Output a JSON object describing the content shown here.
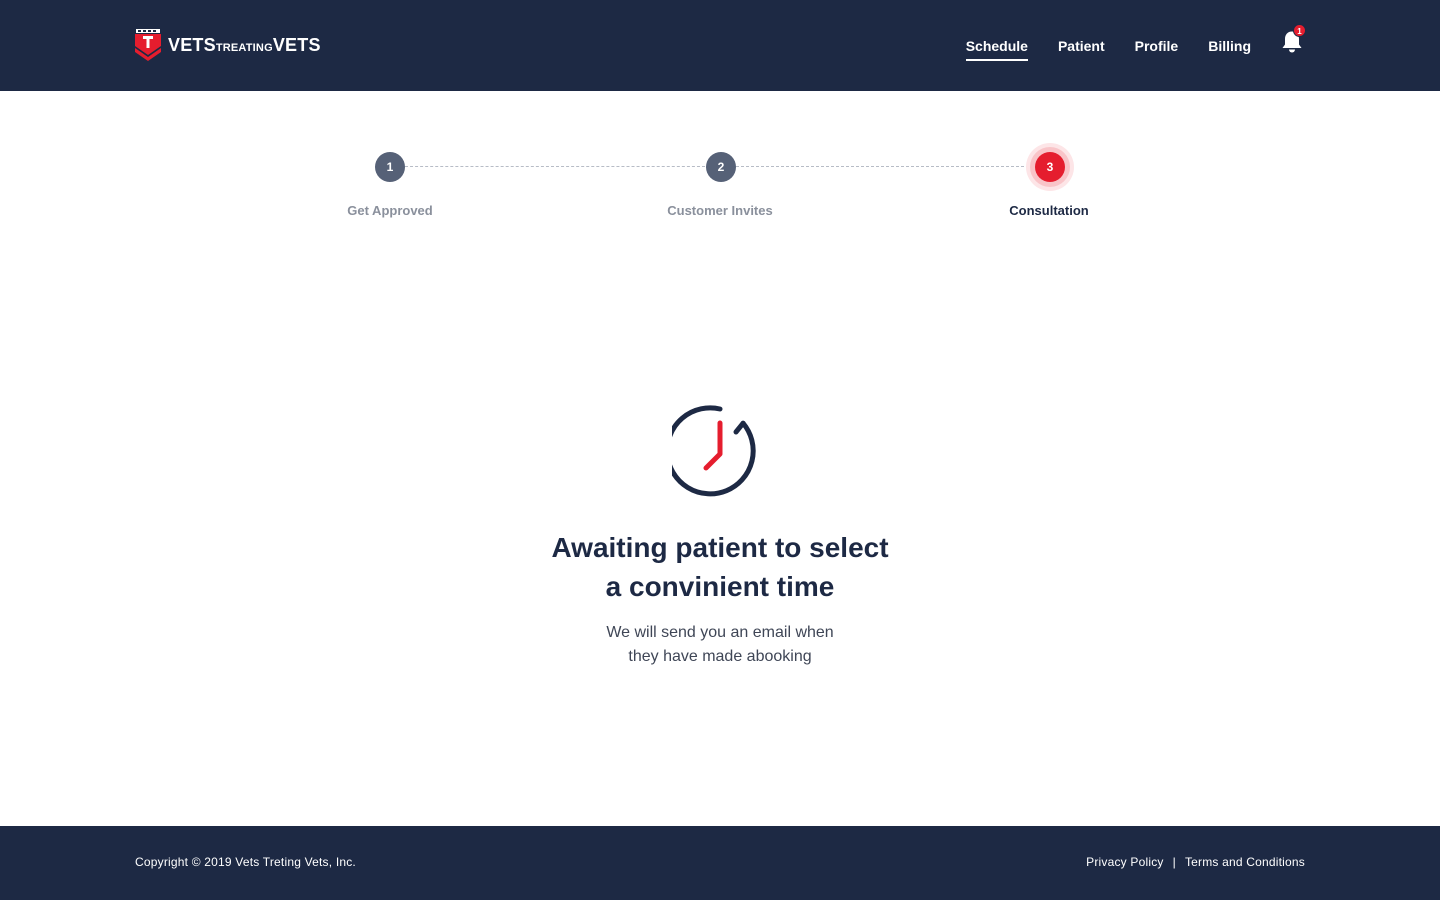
{
  "header": {
    "logo": {
      "word_1": "VETS",
      "word_2": "TREATING",
      "word_3": "VETS",
      "icon": "shield-logo-icon"
    },
    "nav": [
      {
        "label": "Schedule",
        "active": true
      },
      {
        "label": "Patient",
        "active": false
      },
      {
        "label": "Profile",
        "active": false
      },
      {
        "label": "Billing",
        "active": false
      }
    ],
    "notifications": {
      "icon": "bell-icon",
      "count": "1"
    }
  },
  "stepper": {
    "steps": [
      {
        "number": "1",
        "label": "Get Approved",
        "state": "done"
      },
      {
        "number": "2",
        "label": "Customer Invites",
        "state": "done"
      },
      {
        "number": "3",
        "label": "Consultation",
        "state": "current"
      }
    ]
  },
  "main": {
    "icon": "clock-icon",
    "title_line_1": "Awaiting patient to select",
    "title_line_2": "a convinient time",
    "message_line_1": "We will send you an email when",
    "message_line_2": "they have made abooking"
  },
  "footer": {
    "copyright": "Copyright © 2019 Vets Treting Vets, Inc.",
    "separator": "|",
    "privacy_label": "Privacy Policy",
    "terms_label": "Terms and Conditions"
  },
  "colors": {
    "navy": "#1d2944",
    "accent_red": "#e51d2e",
    "step_done": "#566177",
    "muted_text": "#8a909c"
  }
}
